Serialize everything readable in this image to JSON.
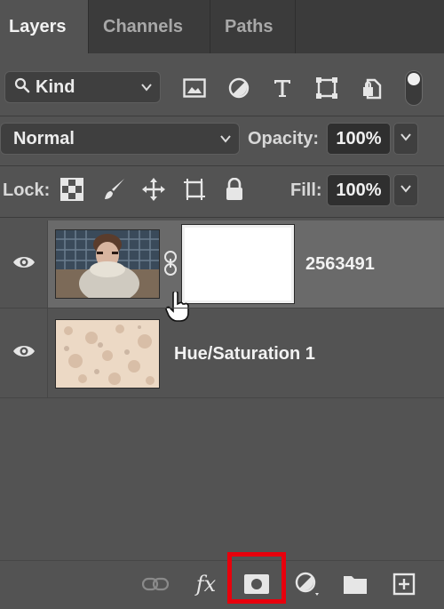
{
  "tabs": [
    {
      "label": "Layers",
      "active": true
    },
    {
      "label": "Channels",
      "active": false
    },
    {
      "label": "Paths",
      "active": false
    }
  ],
  "filter": {
    "kind_label": "Kind",
    "icons": [
      "image-filter-icon",
      "adjustment-filter-icon",
      "type-filter-icon",
      "shape-filter-icon",
      "smart-object-filter-icon"
    ],
    "toggle_on": true
  },
  "blend": {
    "mode": "Normal",
    "opacity_label": "Opacity:",
    "opacity_value": "100%"
  },
  "lock": {
    "label": "Lock:",
    "icons": [
      "lock-transparent-pixels-icon",
      "lock-image-pixels-icon",
      "lock-position-icon",
      "lock-artboard-icon",
      "lock-all-icon"
    ],
    "fill_label": "Fill:",
    "fill_value": "100%"
  },
  "layers": [
    {
      "name": "2563491",
      "visible": true,
      "selected": true,
      "has_mask": true
    },
    {
      "name": "Hue/Saturation 1",
      "visible": true,
      "selected": false,
      "has_mask": false
    }
  ],
  "bottom_bar": {
    "icons": [
      "link-layers-icon",
      "layer-style-fx-icon",
      "add-layer-mask-icon",
      "adjustment-layer-icon",
      "new-group-icon",
      "new-layer-icon"
    ],
    "fx_label": "fx",
    "highlighted": "add-layer-mask-icon",
    "highlight_color": "#e8000c"
  },
  "colors": {
    "panel": "#535353",
    "tab_bar": "#3b3b3b",
    "selected_row": "#6a6a6a"
  }
}
